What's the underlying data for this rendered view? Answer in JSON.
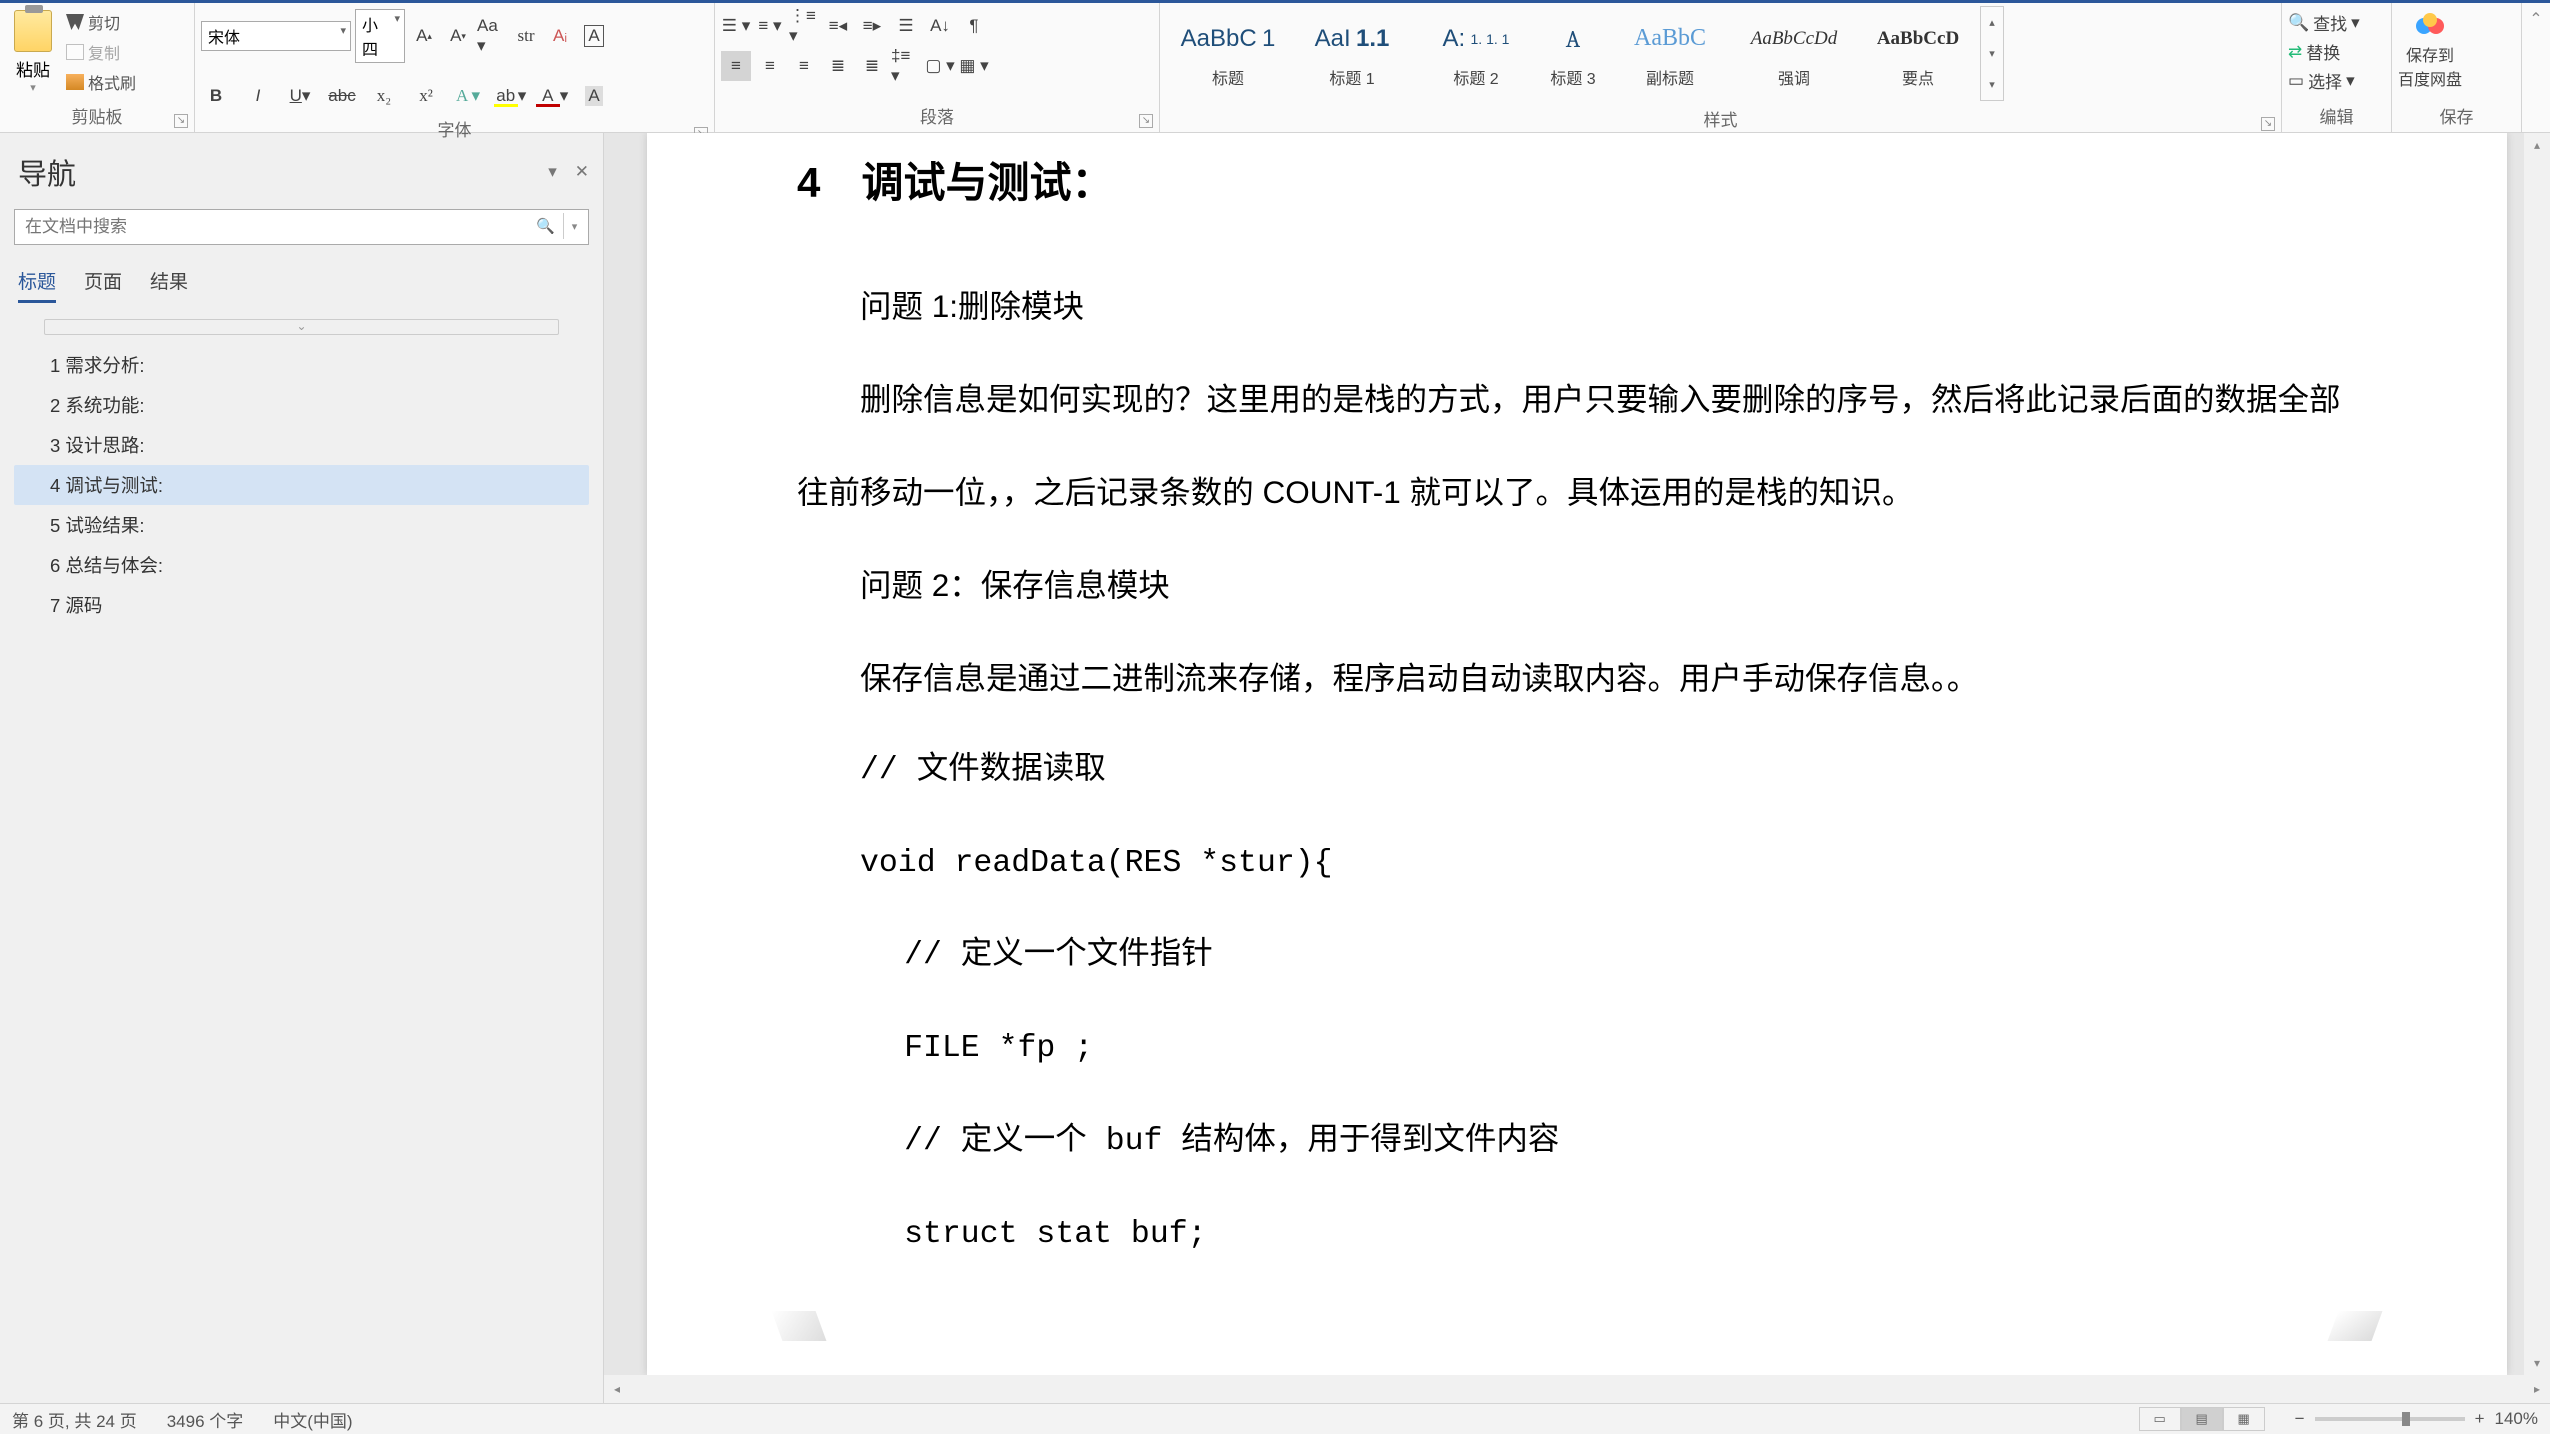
{
  "ribbon": {
    "clipboard": {
      "paste": "粘贴",
      "cut": "剪切",
      "copy": "复制",
      "painter": "格式刷",
      "label": "剪贴板"
    },
    "font": {
      "name": "宋体",
      "size": "小四",
      "label": "字体"
    },
    "paragraph": {
      "label": "段落"
    },
    "styles": {
      "items": [
        {
          "preview": "AaBbC",
          "num": "1",
          "name": "标题"
        },
        {
          "preview": "AaI",
          "num": "1.1",
          "name": "标题 1"
        },
        {
          "preview": "A:",
          "num": "1. 1. 1",
          "name": "标题 2"
        },
        {
          "preview": "A",
          "num": "",
          "name": "标题 3"
        },
        {
          "preview": "AaBbC",
          "num": "",
          "name": "副标题"
        },
        {
          "preview": "AaBbCcDd",
          "num": "",
          "name": "强调"
        },
        {
          "preview": "AaBbCcD",
          "num": "",
          "name": "要点"
        }
      ],
      "label": "样式"
    },
    "edit": {
      "find": "查找",
      "replace": "替换",
      "select": "选择",
      "label": "编辑"
    },
    "cloud": {
      "line1": "保存到",
      "line2": "百度网盘",
      "label": "保存"
    }
  },
  "nav": {
    "title": "导航",
    "search_placeholder": "在文档中搜索",
    "tabs": {
      "headings": "标题",
      "pages": "页面",
      "results": "结果"
    },
    "tree": [
      "1 需求分析:",
      "2 系统功能:",
      "3 设计思路:",
      "4 调试与测试:",
      "5 试验结果:",
      "6 总结与体会:",
      "7 源码"
    ],
    "selected_index": 3
  },
  "doc": {
    "heading_num": "4",
    "heading_txt": "调试与测试：",
    "p1": "问题 1:删除模块",
    "p2": "删除信息是如何实现的？这里用的是栈的方式，用户只要输入要删除的序号，然后将此记录后面的数据全部往前移动一位，，之后记录条数的 COUNT-1 就可以了。具体运用的是栈的知识。",
    "p3": "问题 2：保存信息模块",
    "p4": "保存信息是通过二进制流来存储，程序启动自动读取内容。用户手动保存信息。。",
    "c1": "// 文件数据读取",
    "c2": "void readData(RES *stur){",
    "c3": "// 定义一个文件指针",
    "c4": "FILE *fp ;",
    "c5": "// 定义一个 buf 结构体，用于得到文件内容",
    "c6": "struct stat buf;"
  },
  "status": {
    "page": "第 6 页, 共 24 页",
    "words": "3496 个字",
    "lang": "中文(中国)",
    "zoom": "140%"
  }
}
